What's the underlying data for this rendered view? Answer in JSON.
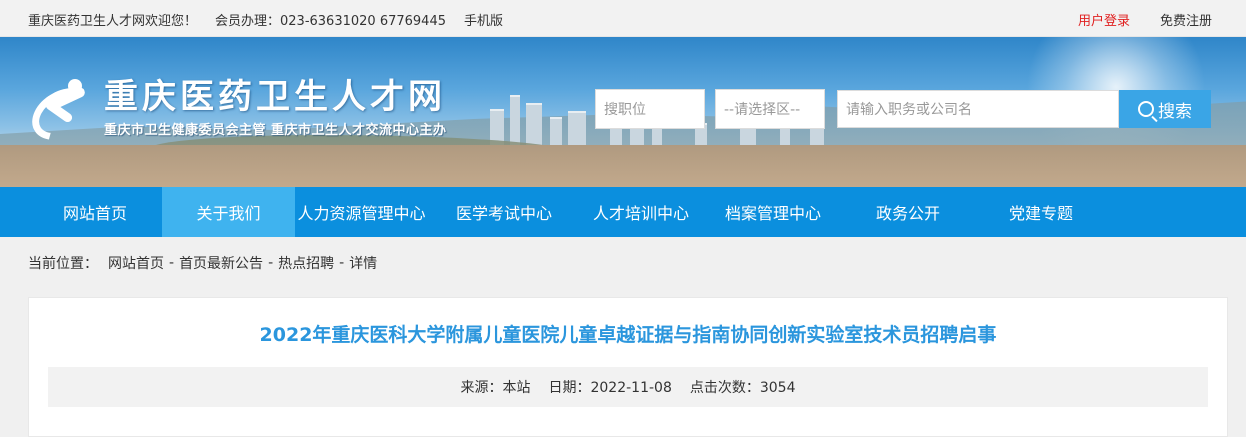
{
  "topbar": {
    "welcome": "重庆医药卫生人才网欢迎您！",
    "member_phone": "会员办理：023-63631020 67769445",
    "mobile": "手机版",
    "login": "用户登录",
    "register": "免费注册"
  },
  "header": {
    "site_title": "重庆医药卫生人才网",
    "site_subtitle": "重庆市卫生健康委员会主管  重庆市卫生人才交流中心主办"
  },
  "search": {
    "position_placeholder": "搜职位",
    "area_placeholder": "--请选择区--",
    "keyword_placeholder": "请输入职务或公司名",
    "button_label": "搜索"
  },
  "nav": {
    "items": [
      {
        "label": "网站首页"
      },
      {
        "label": "关于我们"
      },
      {
        "label": "人力资源管理中心"
      },
      {
        "label": "医学考试中心"
      },
      {
        "label": "人才培训中心"
      },
      {
        "label": "档案管理中心"
      },
      {
        "label": "政务公开"
      },
      {
        "label": "党建专题"
      }
    ],
    "active_index": 1
  },
  "breadcrumb": {
    "prefix": "当前位置：",
    "items": [
      "网站首页",
      "首页最新公告",
      "热点招聘",
      "详情"
    ],
    "separator": "-"
  },
  "article": {
    "title": "2022年重庆医科大学附属儿童医院儿童卓越证据与指南协同创新实验室技术员招聘启事",
    "source": "来源：本站",
    "date": "日期：2022-11-08",
    "clicks": "点击次数：3054"
  },
  "colors": {
    "nav_bg": "#0b8fde",
    "nav_active": "#3fb3ef",
    "title_blue": "#2b96dd",
    "login_red": "#e02020",
    "search_button": "#3aa5e6"
  }
}
